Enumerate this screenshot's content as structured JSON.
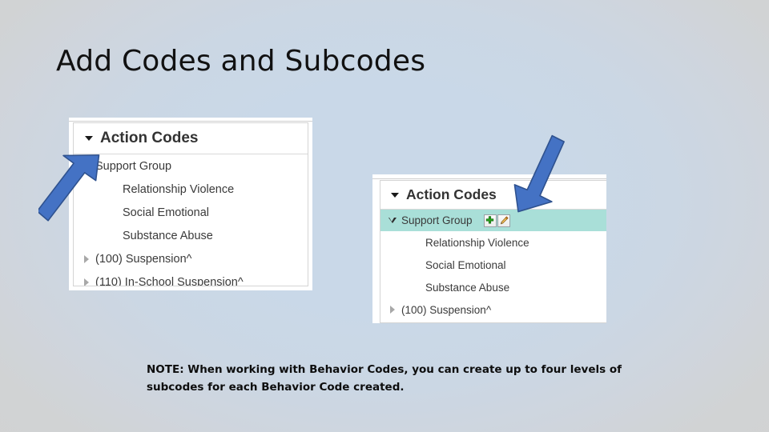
{
  "slide": {
    "title": "Add Codes and Subcodes",
    "background_center_color": "#c9d8e8",
    "background_edge_color": "#d2d2d2"
  },
  "panel_left": {
    "header": {
      "title": "Action Codes",
      "caret": "caret-down-icon"
    },
    "rows": [
      {
        "label": "Support Group",
        "indent": 0,
        "caret": "caret-down-icon",
        "selected": false
      },
      {
        "label": "Relationship Violence",
        "indent": 1,
        "caret": "none",
        "selected": false
      },
      {
        "label": "Social Emotional",
        "indent": 1,
        "caret": "none",
        "selected": false
      },
      {
        "label": "Substance Abuse",
        "indent": 1,
        "caret": "none",
        "selected": false
      },
      {
        "label": "(100) Suspension^",
        "indent": 0,
        "caret": "caret-right-icon",
        "selected": false
      },
      {
        "label": "(110) In-School Suspension^",
        "indent": 0,
        "caret": "caret-right-icon",
        "selected": false
      }
    ]
  },
  "panel_right": {
    "header": {
      "title": "Action Codes",
      "caret": "caret-down-icon"
    },
    "rows": [
      {
        "label": "Support Group",
        "indent": 0,
        "caret": "caret-down-hollow-icon",
        "selected": true,
        "actions": [
          "add-icon",
          "edit-icon"
        ]
      },
      {
        "label": "Relationship Violence",
        "indent": 1,
        "caret": "none",
        "selected": false
      },
      {
        "label": "Social Emotional",
        "indent": 1,
        "caret": "none",
        "selected": false
      },
      {
        "label": "Substance Abuse",
        "indent": 1,
        "caret": "none",
        "selected": false
      },
      {
        "label": "(100) Suspension^",
        "indent": 0,
        "caret": "caret-right-icon",
        "selected": false
      }
    ],
    "highlight_color": "#a9dfd8",
    "add_button": {
      "name": "add-subcode-button",
      "icon": "green-plus-icon",
      "color": "#2ba01f"
    },
    "edit_button": {
      "name": "edit-code-button",
      "icon": "pencil-icon",
      "color": "#e8a33d"
    }
  },
  "arrows": {
    "color": "#4472c4",
    "outline_color": "#2f528f",
    "left": {
      "name": "arrow-pointing-to-support-group-expander",
      "direction": "up-right"
    },
    "right": {
      "name": "arrow-pointing-to-support-group-row",
      "direction": "down-left"
    }
  },
  "note": {
    "line1": "NOTE: When working with Behavior Codes, you can create up to four levels of",
    "line2": "subcodes for each Behavior Code created."
  }
}
